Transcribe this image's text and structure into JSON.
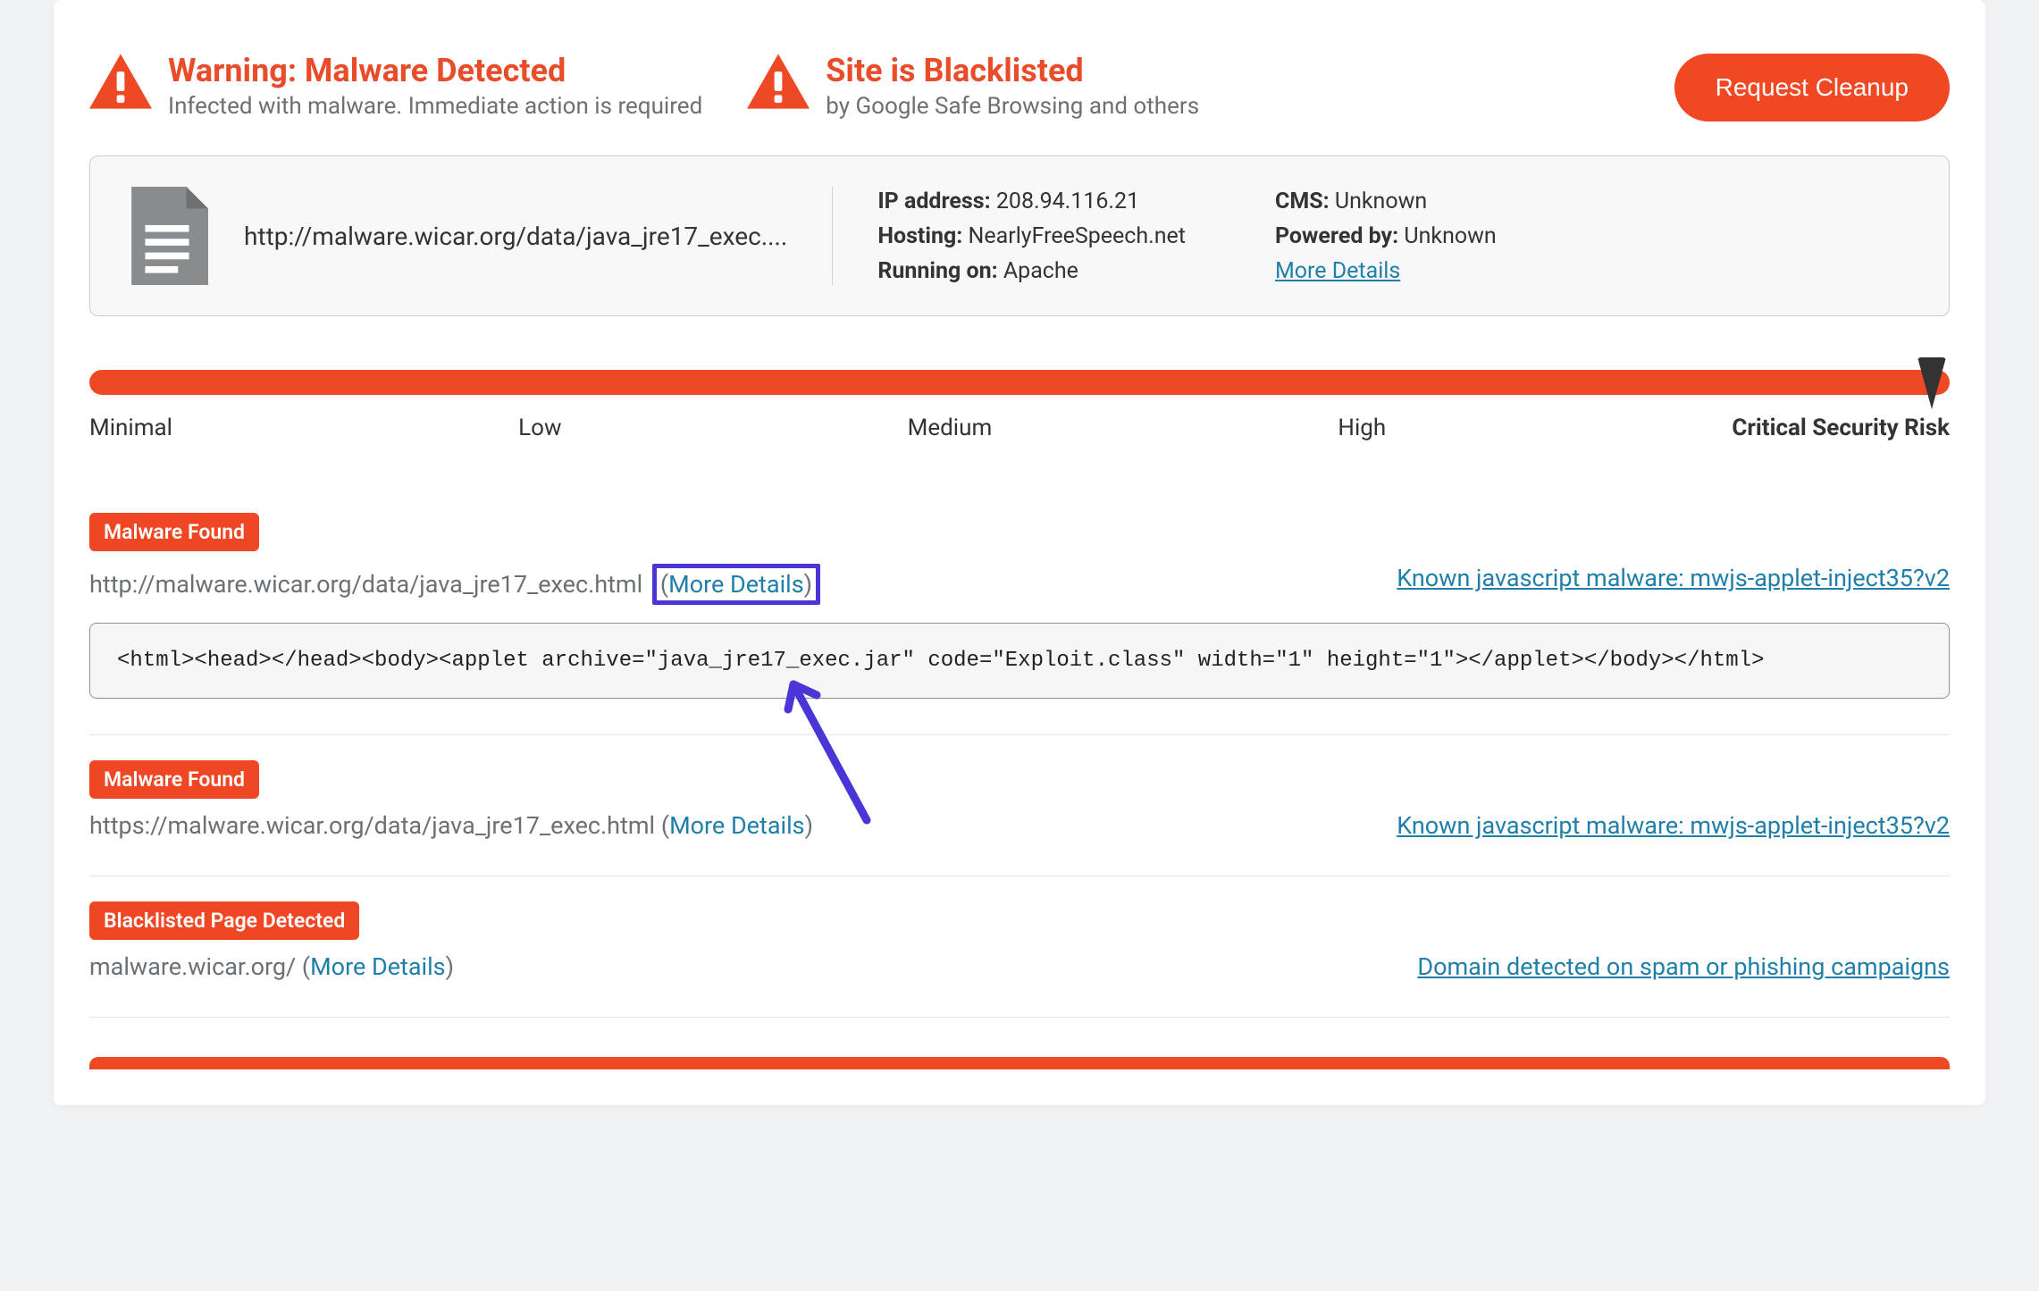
{
  "header": {
    "alert1": {
      "title": "Warning: Malware Detected",
      "subtitle": "Infected with malware. Immediate action is required"
    },
    "alert2": {
      "title": "Site is Blacklisted",
      "subtitle": "by Google Safe Browsing and others"
    },
    "cleanup_label": "Request Cleanup"
  },
  "site": {
    "url_display": "http://malware.wicar.org/data/java_jre17_exec....",
    "meta_col1": {
      "ip_label": "IP address:",
      "ip_value": "208.94.116.21",
      "hosting_label": "Hosting:",
      "hosting_value": "NearlyFreeSpeech.net",
      "running_label": "Running on:",
      "running_value": "Apache"
    },
    "meta_col2": {
      "cms_label": "CMS:",
      "cms_value": "Unknown",
      "powered_label": "Powered by:",
      "powered_value": "Unknown",
      "more_details": "More Details"
    }
  },
  "risk": {
    "labels": [
      "Minimal",
      "Low",
      "Medium",
      "High",
      "Critical Security Risk"
    ]
  },
  "findings": [
    {
      "badge": "Malware Found",
      "url": "http://malware.wicar.org/data/java_jre17_exec.html",
      "more_details": "More Details",
      "highlight_box": true,
      "type_link": "Known javascript malware: mwjs-applet-inject35?v2",
      "code": "<html><head></head><body><applet archive=\"java_jre17_exec.jar\" code=\"Exploit.class\" width=\"1\" height=\"1\"></applet></body></html>"
    },
    {
      "badge": "Malware Found",
      "url": "https://malware.wicar.org/data/java_jre17_exec.html ",
      "more_details": "More Details",
      "highlight_box": false,
      "type_link": "Known javascript malware: mwjs-applet-inject35?v2"
    },
    {
      "badge": "Blacklisted Page Detected",
      "url": "malware.wicar.org/ ",
      "more_details": "More Details",
      "highlight_box": false,
      "type_link": "Domain detected on spam or phishing campaigns"
    }
  ]
}
